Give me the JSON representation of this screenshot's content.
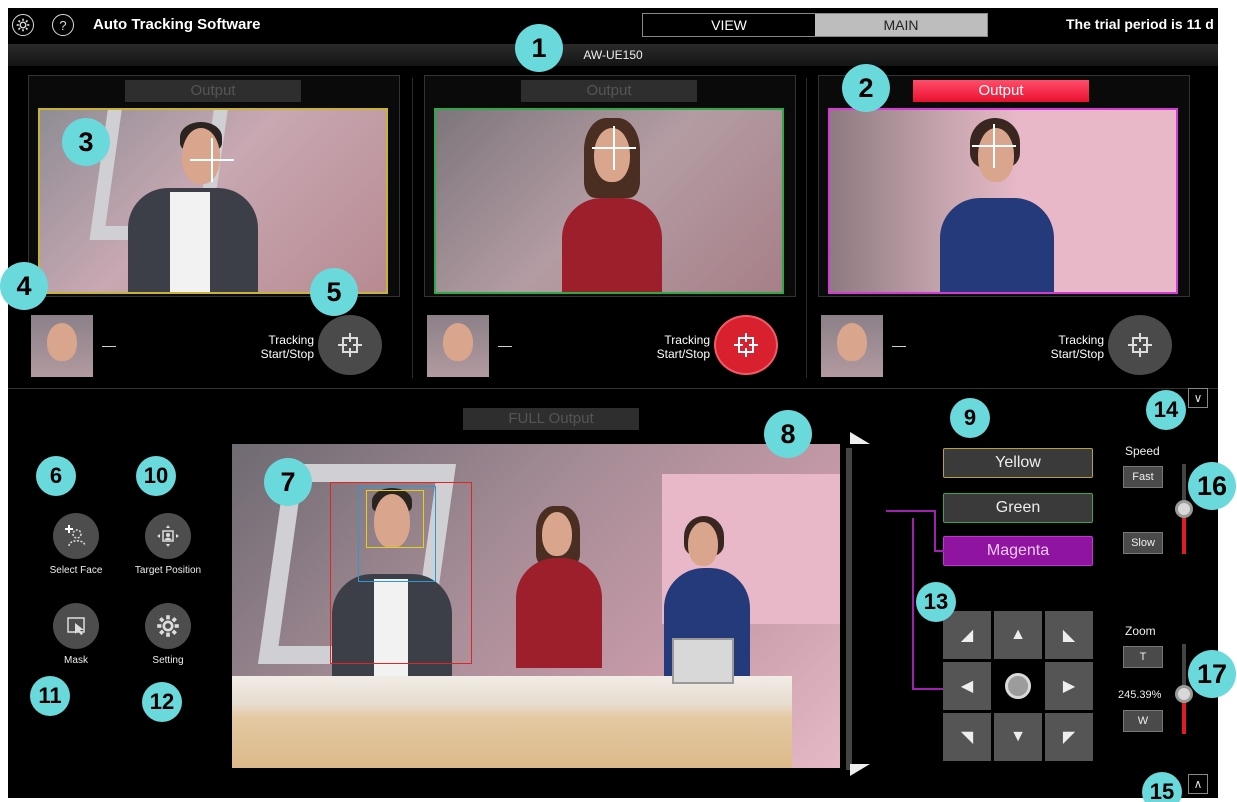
{
  "topbar": {
    "settings_icon": "gear-icon",
    "help_glyph": "?",
    "title": "Auto Tracking Software",
    "tabs": [
      "VIEW",
      "MAIN"
    ],
    "trial_text": "The trial period is 11 d"
  },
  "camera_name": "AW-UE150",
  "cameras": [
    {
      "output_label": "Output",
      "output_active": false,
      "frame_color": "#c9b23a",
      "dash": "—",
      "tracking_label": "Tracking Start/Stop",
      "tracking_active": false
    },
    {
      "output_label": "Output",
      "output_active": false,
      "frame_color": "#2fa84a",
      "dash": "—",
      "tracking_label": "Tracking Start/Stop",
      "tracking_active": true
    },
    {
      "output_label": "Output",
      "output_active": true,
      "frame_color": "#d43ad6",
      "dash": "—",
      "tracking_label": "Tracking Start/Stop",
      "tracking_active": false
    }
  ],
  "full_output_label": "FULL Output",
  "tools": {
    "select_face": "Select Face",
    "target_position": "Target Position",
    "mask": "Mask",
    "setting": "Setting"
  },
  "colors": {
    "yellow": "Yellow",
    "green": "Green",
    "magenta": "Magenta"
  },
  "speed": {
    "label": "Speed",
    "fast": "Fast",
    "slow": "Slow",
    "level": 0.5
  },
  "zoom": {
    "label": "Zoom",
    "tele": "T",
    "wide": "W",
    "percent": "245.39%",
    "level": 0.45
  },
  "callouts": [
    "1",
    "2",
    "3",
    "4",
    "5",
    "6",
    "7",
    "8",
    "9",
    "10",
    "11",
    "12",
    "13",
    "14",
    "15",
    "16",
    "17"
  ],
  "accent_colors": {
    "callout": "#6ad9dc",
    "active_red": "#e8102f",
    "magenta": "#a020b0"
  }
}
